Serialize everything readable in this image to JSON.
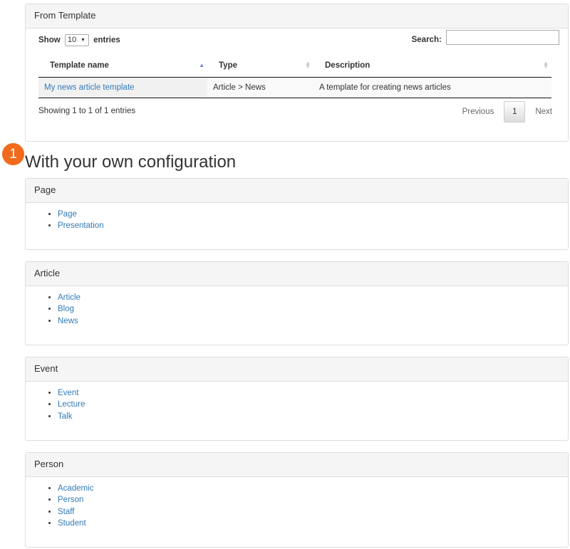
{
  "from_template": {
    "heading": "From Template",
    "show_label": "Show",
    "length_value": "10",
    "entries_label": "entries",
    "search_label": "Search:",
    "search_value": "",
    "columns": [
      "Template name",
      "Type",
      "Description"
    ],
    "rows": [
      {
        "name": "My news article template",
        "type": "Article > News",
        "description": "A template for creating news articles"
      }
    ],
    "info": "Showing 1 to 1 of 1 entries",
    "pagination": {
      "previous": "Previous",
      "current": "1",
      "next": "Next"
    }
  },
  "badge": "1",
  "section_title": "With your own configuration",
  "panels": [
    {
      "heading": "Page",
      "items": [
        "Page",
        "Presentation"
      ]
    },
    {
      "heading": "Article",
      "items": [
        "Article",
        "Blog",
        "News"
      ]
    },
    {
      "heading": "Event",
      "items": [
        "Event",
        "Lecture",
        "Talk"
      ]
    },
    {
      "heading": "Person",
      "items": [
        "Academic",
        "Person",
        "Staff",
        "Student"
      ]
    }
  ],
  "colors": {
    "link": "#337ab7",
    "badge": "#f26a1b",
    "sort_active": "#6e82d6"
  }
}
